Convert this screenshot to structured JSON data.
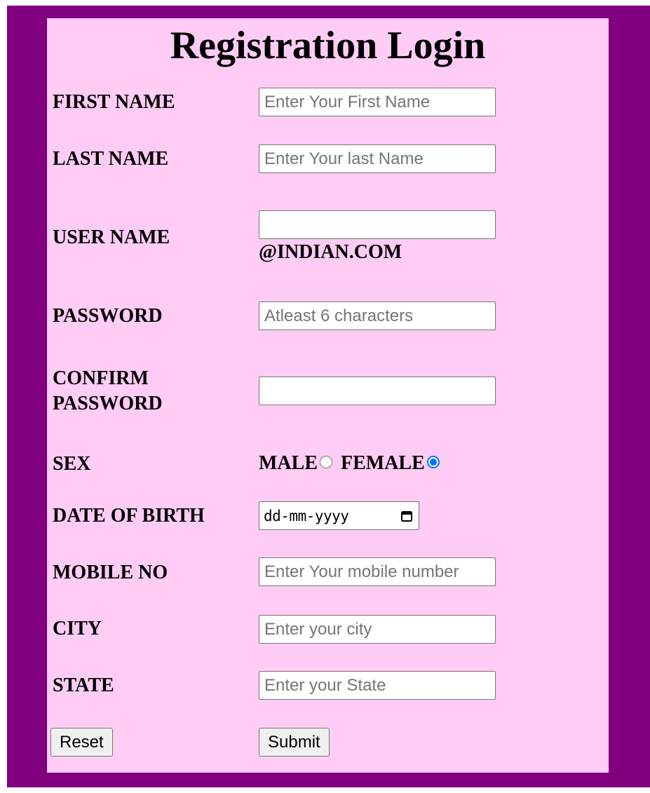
{
  "form": {
    "title": "Registration Login",
    "first_name": {
      "label": "FIRST NAME",
      "placeholder": "Enter Your First Name",
      "value": ""
    },
    "last_name": {
      "label": "LAST NAME",
      "placeholder": "Enter Your last Name",
      "value": ""
    },
    "user_name": {
      "label": "USER NAME",
      "placeholder": "",
      "value": "",
      "suffix": "@INDIAN.COM"
    },
    "password": {
      "label": "PASSWORD",
      "placeholder": "Atleast 6 characters",
      "value": ""
    },
    "confirm_password": {
      "label_line1": "CONFIRM",
      "label_line2": "PASSWORD",
      "placeholder": "",
      "value": ""
    },
    "sex": {
      "label": "SEX",
      "options": [
        "MALE",
        "FEMALE"
      ],
      "selected": "FEMALE"
    },
    "dob": {
      "label": "DATE OF BIRTH",
      "placeholder": "dd-mm-yyyy",
      "icon": "calendar-icon"
    },
    "mobile": {
      "label": "MOBILE NO",
      "placeholder": "Enter Your mobile number",
      "value": ""
    },
    "city": {
      "label": "CITY",
      "placeholder": "Enter your city",
      "value": ""
    },
    "state": {
      "label": "STATE",
      "placeholder": "Enter your State",
      "value": ""
    },
    "reset_label": "Reset",
    "submit_label": "Submit"
  },
  "colors": {
    "frame": "#800080",
    "card": "#ffccf5",
    "radio_accent": "#0075ff"
  }
}
